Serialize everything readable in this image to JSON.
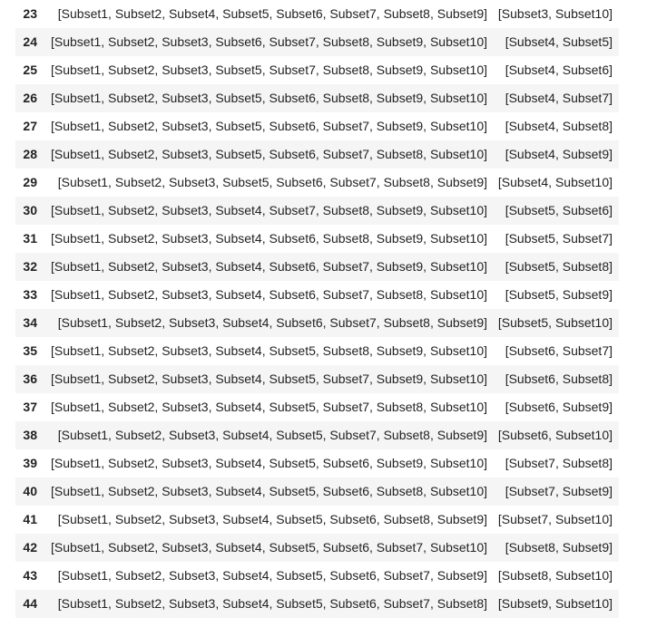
{
  "rows": [
    {
      "index": "23",
      "col1": "[Subset1, Subset2, Subset4, Subset5, Subset6, Subset7, Subset8, Subset9]",
      "col2": "[Subset3, Subset10]"
    },
    {
      "index": "24",
      "col1": "[Subset1, Subset2, Subset3, Subset6, Subset7, Subset8, Subset9, Subset10]",
      "col2": "[Subset4, Subset5]"
    },
    {
      "index": "25",
      "col1": "[Subset1, Subset2, Subset3, Subset5, Subset7, Subset8, Subset9, Subset10]",
      "col2": "[Subset4, Subset6]"
    },
    {
      "index": "26",
      "col1": "[Subset1, Subset2, Subset3, Subset5, Subset6, Subset8, Subset9, Subset10]",
      "col2": "[Subset4, Subset7]"
    },
    {
      "index": "27",
      "col1": "[Subset1, Subset2, Subset3, Subset5, Subset6, Subset7, Subset9, Subset10]",
      "col2": "[Subset4, Subset8]"
    },
    {
      "index": "28",
      "col1": "[Subset1, Subset2, Subset3, Subset5, Subset6, Subset7, Subset8, Subset10]",
      "col2": "[Subset4, Subset9]"
    },
    {
      "index": "29",
      "col1": "[Subset1, Subset2, Subset3, Subset5, Subset6, Subset7, Subset8, Subset9]",
      "col2": "[Subset4, Subset10]"
    },
    {
      "index": "30",
      "col1": "[Subset1, Subset2, Subset3, Subset4, Subset7, Subset8, Subset9, Subset10]",
      "col2": "[Subset5, Subset6]"
    },
    {
      "index": "31",
      "col1": "[Subset1, Subset2, Subset3, Subset4, Subset6, Subset8, Subset9, Subset10]",
      "col2": "[Subset5, Subset7]"
    },
    {
      "index": "32",
      "col1": "[Subset1, Subset2, Subset3, Subset4, Subset6, Subset7, Subset9, Subset10]",
      "col2": "[Subset5, Subset8]"
    },
    {
      "index": "33",
      "col1": "[Subset1, Subset2, Subset3, Subset4, Subset6, Subset7, Subset8, Subset10]",
      "col2": "[Subset5, Subset9]"
    },
    {
      "index": "34",
      "col1": "[Subset1, Subset2, Subset3, Subset4, Subset6, Subset7, Subset8, Subset9]",
      "col2": "[Subset5, Subset10]"
    },
    {
      "index": "35",
      "col1": "[Subset1, Subset2, Subset3, Subset4, Subset5, Subset8, Subset9, Subset10]",
      "col2": "[Subset6, Subset7]"
    },
    {
      "index": "36",
      "col1": "[Subset1, Subset2, Subset3, Subset4, Subset5, Subset7, Subset9, Subset10]",
      "col2": "[Subset6, Subset8]"
    },
    {
      "index": "37",
      "col1": "[Subset1, Subset2, Subset3, Subset4, Subset5, Subset7, Subset8, Subset10]",
      "col2": "[Subset6, Subset9]"
    },
    {
      "index": "38",
      "col1": "[Subset1, Subset2, Subset3, Subset4, Subset5, Subset7, Subset8, Subset9]",
      "col2": "[Subset6, Subset10]"
    },
    {
      "index": "39",
      "col1": "[Subset1, Subset2, Subset3, Subset4, Subset5, Subset6, Subset9, Subset10]",
      "col2": "[Subset7, Subset8]"
    },
    {
      "index": "40",
      "col1": "[Subset1, Subset2, Subset3, Subset4, Subset5, Subset6, Subset8, Subset10]",
      "col2": "[Subset7, Subset9]"
    },
    {
      "index": "41",
      "col1": "[Subset1, Subset2, Subset3, Subset4, Subset5, Subset6, Subset8, Subset9]",
      "col2": "[Subset7, Subset10]"
    },
    {
      "index": "42",
      "col1": "[Subset1, Subset2, Subset3, Subset4, Subset5, Subset6, Subset7, Subset10]",
      "col2": "[Subset8, Subset9]"
    },
    {
      "index": "43",
      "col1": "[Subset1, Subset2, Subset3, Subset4, Subset5, Subset6, Subset7, Subset9]",
      "col2": "[Subset8, Subset10]"
    },
    {
      "index": "44",
      "col1": "[Subset1, Subset2, Subset3, Subset4, Subset5, Subset6, Subset7, Subset8]",
      "col2": "[Subset9, Subset10]"
    }
  ]
}
